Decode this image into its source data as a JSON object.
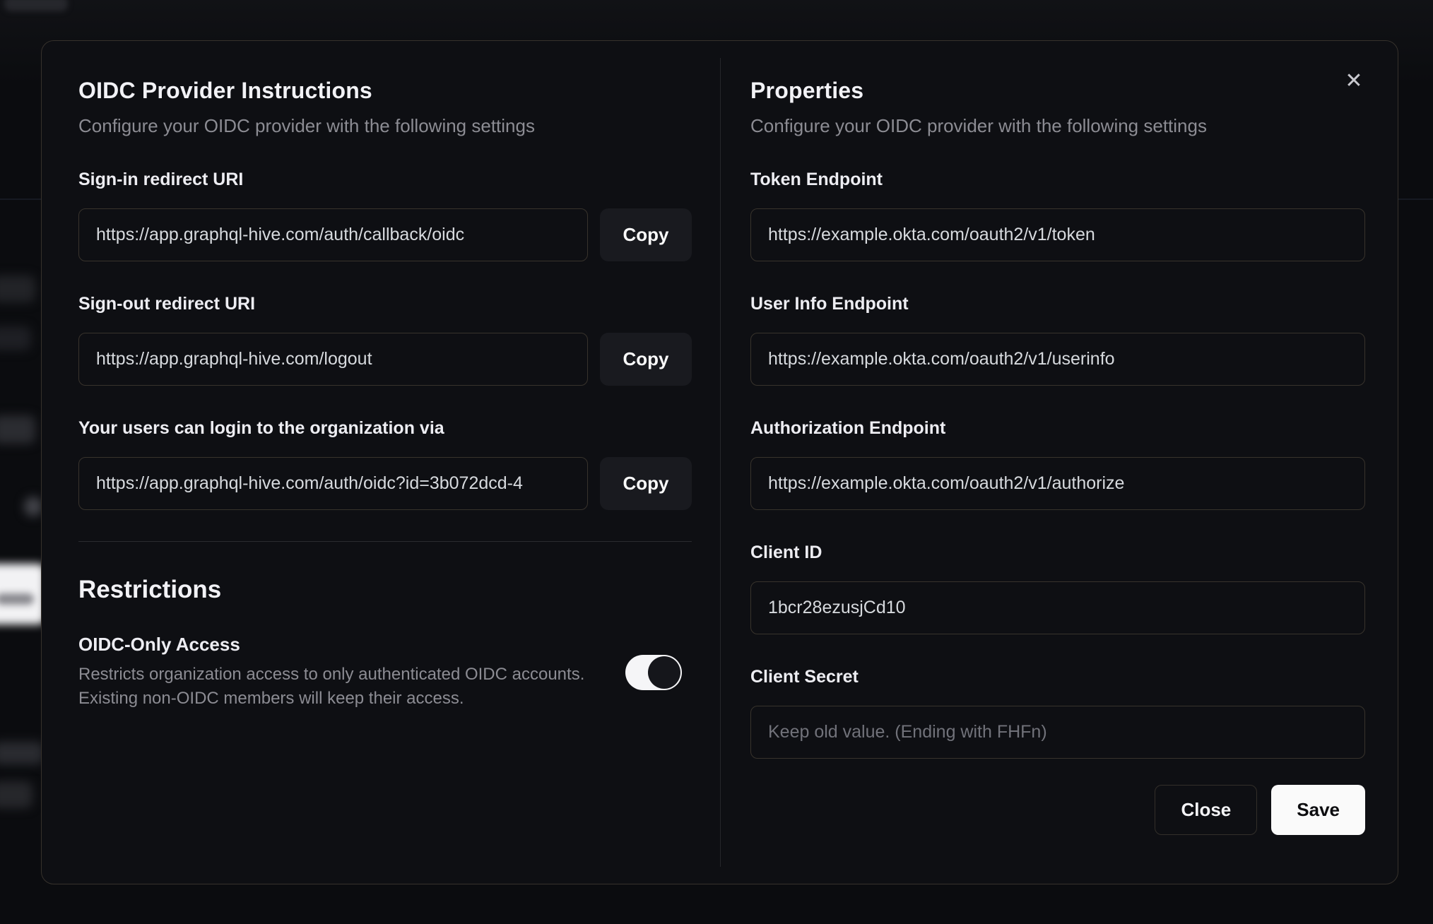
{
  "modal": {
    "close_icon": "✕",
    "left": {
      "title": "OIDC Provider Instructions",
      "subtitle": "Configure your OIDC provider with the following settings",
      "fields": [
        {
          "label": "Sign-in redirect URI",
          "value": "https://app.graphql-hive.com/auth/callback/oidc",
          "copy_label": "Copy"
        },
        {
          "label": "Sign-out redirect URI",
          "value": "https://app.graphql-hive.com/logout",
          "copy_label": "Copy"
        },
        {
          "label": "Your users can login to the organization via",
          "value": "https://app.graphql-hive.com/auth/oidc?id=3b072dcd-4",
          "copy_label": "Copy"
        }
      ],
      "restrictions": {
        "title": "Restrictions",
        "toggle_label": "OIDC-Only Access",
        "toggle_description_line1": "Restricts organization access to only authenticated OIDC accounts.",
        "toggle_description_line2": "Existing non-OIDC members will keep their access.",
        "toggle_state": "on"
      }
    },
    "right": {
      "title": "Properties",
      "subtitle": "Configure your OIDC provider with the following settings",
      "fields": [
        {
          "label": "Token Endpoint",
          "value": "https://example.okta.com/oauth2/v1/token"
        },
        {
          "label": "User Info Endpoint",
          "value": "https://example.okta.com/oauth2/v1/userinfo"
        },
        {
          "label": "Authorization Endpoint",
          "value": "https://example.okta.com/oauth2/v1/authorize"
        },
        {
          "label": "Client ID",
          "value": "1bcr28ezusjCd10"
        },
        {
          "label": "Client Secret",
          "value": "",
          "placeholder": "Keep old value. (Ending with FHFn)"
        }
      ],
      "buttons": {
        "close": "Close",
        "save": "Save"
      }
    }
  },
  "colors": {
    "page_background": "#0b0c0f",
    "modal_background": "#0e0f13",
    "modal_border": "#37322c",
    "input_border": "#38332c",
    "accent_button_background": "#fafafa",
    "accent_button_text": "#0c0c0f",
    "muted_text": "#8c8c93",
    "toggle_track": "#f5f5f7",
    "toggle_thumb": "#15161b"
  }
}
